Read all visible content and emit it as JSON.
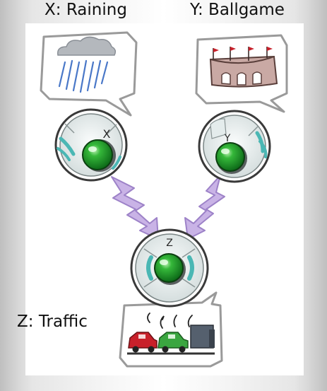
{
  "labels": {
    "x": "X: Raining",
    "y": "Y: Ballgame",
    "z": "Z: Traffic"
  },
  "nodes": {
    "x_letter": "X",
    "y_letter": "Y",
    "z_letter": "Z"
  },
  "colors": {
    "node_green": "#1f9a2c",
    "node_ring": "#e6eded",
    "accent_teal": "#4ab7b4",
    "arrow_purple": "#c9b3e6",
    "rain_blue": "#4a78c8",
    "car_red": "#c8202a",
    "car_green": "#3aa640",
    "truck_gray": "#55606e"
  },
  "icons": [
    "rain-cloud-icon",
    "stadium-icon",
    "cars-traffic-icon",
    "lightning-arrow-icon"
  ]
}
